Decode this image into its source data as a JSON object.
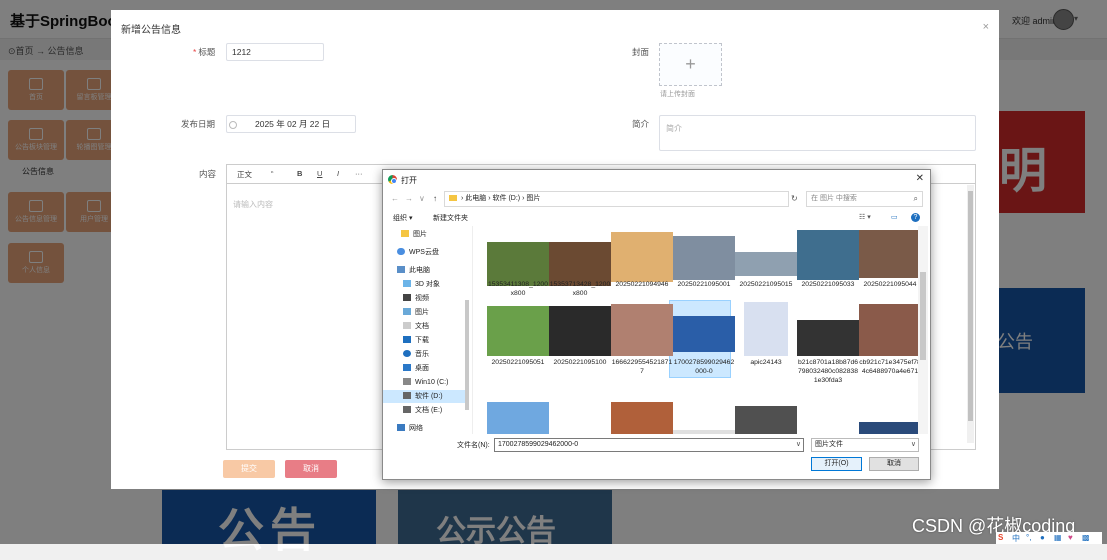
{
  "app": {
    "title": "基于SpringBoot的",
    "welcome": "欢迎 admin",
    "breadcrumb": "⊙首页 → 公告信息",
    "menu_text": "公告信息",
    "tiles": [
      "首页",
      "留言板管理",
      "公告板块管理",
      "轮播图管理",
      "公告信息管理",
      "用户管理",
      "个人信息"
    ],
    "posters": {
      "red_char": "明",
      "blue_right": "公告",
      "blue_1": "公告",
      "blue_2": "公示公告"
    }
  },
  "modal": {
    "title": "新增公告信息",
    "close": "×",
    "fields": {
      "title_label": "标题",
      "title_value": "1212",
      "cover_label": "封面",
      "cover_hint": "请上传封面",
      "date_label": "发布日期",
      "date_value": "2025 年 02 月 22 日",
      "intro_label": "简介",
      "intro_placeholder": "简介",
      "content_label": "内容",
      "content_placeholder": "请输入内容"
    },
    "toolbar": [
      "正文",
      "“",
      "B",
      "U",
      "I",
      "···"
    ],
    "submit": "提交",
    "cancel": "取消"
  },
  "dialog": {
    "title": "打开",
    "close": "✕",
    "address": [
      "此电脑",
      "软件 (D:)",
      "图片"
    ],
    "search_placeholder": "在 图片 中搜索",
    "organize": "组织 ▾",
    "new_folder": "新建文件夹",
    "nav_items": [
      "图片",
      "WPS云盘",
      "此电脑",
      "3D 对象",
      "视频",
      "图片",
      "文档",
      "下载",
      "音乐",
      "桌面",
      "Win10 (C:)",
      "软件 (D:)",
      "文档 (E:)",
      "网络"
    ],
    "files": [
      {
        "name": "15353411308_1200x800",
        "color": "#5b7a3a"
      },
      {
        "name": "15353713428_1200x800",
        "color": "#6b4a32"
      },
      {
        "name": "20250221094946",
        "color": "#e0b070"
      },
      {
        "name": "20250221095001",
        "color": "#7f8ea0"
      },
      {
        "name": "20250221095015",
        "color": "#8fa0b0"
      },
      {
        "name": "20250221095033",
        "color": "#3f6e8e"
      },
      {
        "name": "20250221095044",
        "color": "#7a5a48"
      },
      {
        "name": "20250221095051",
        "color": "#6aa04a"
      },
      {
        "name": "20250221095100",
        "color": "#2a2a2a"
      },
      {
        "name": "16662295545218717",
        "color": "#b08070"
      },
      {
        "name": "1700278599029462000-0",
        "color": "#2a5ea8"
      },
      {
        "name": "apic24143",
        "color": "#d8e0f0"
      },
      {
        "name": "b21c8701a18b87d6798032480c0828381e30fda3",
        "color": "#333333"
      },
      {
        "name": "cb921c71e3475ef784c6488970a4e671",
        "color": "#8a5a4a"
      },
      {
        "name": "",
        "color": "#6fa8e0"
      },
      {
        "name": "",
        "color": "#b0603a"
      },
      {
        "name": "",
        "color": "#e0e0e0"
      },
      {
        "name": "",
        "color": "#505050"
      },
      {
        "name": "",
        "color": "#ffffff"
      },
      {
        "name": "",
        "color": "#2a4a7a"
      }
    ],
    "filename_label": "文件名(N):",
    "filename_value": "1700278599029462000-0",
    "filetype": "图片文件",
    "open": "打开(O)",
    "cancel": "取消"
  },
  "watermark": "CSDN @花椒coding"
}
